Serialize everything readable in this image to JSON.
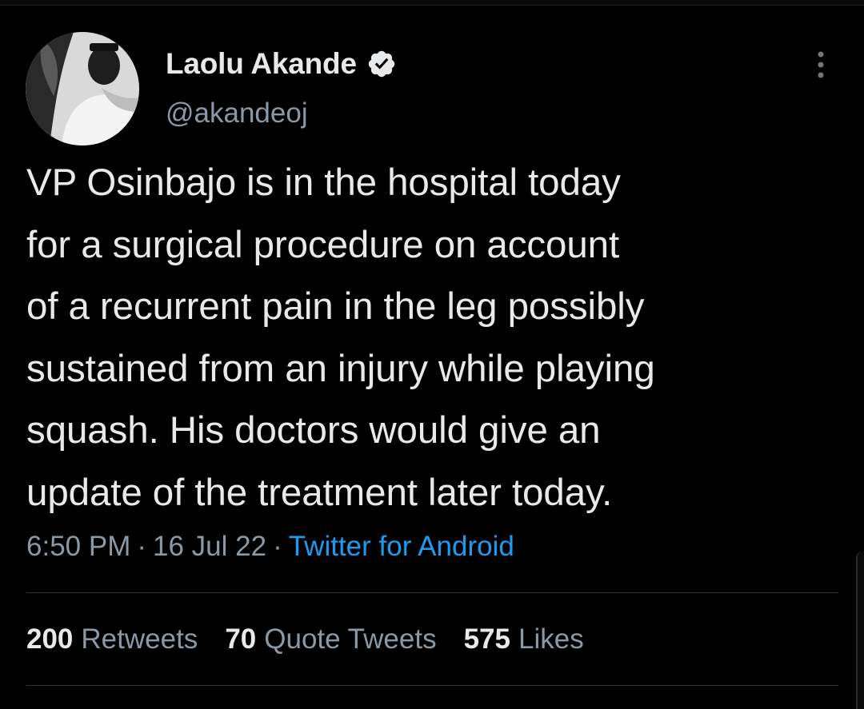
{
  "tweet": {
    "author": {
      "display_name": "Laolu Akande",
      "handle": "@akandeoj",
      "verified": true,
      "avatar_icon": "profile-photo"
    },
    "text": "VP Osinbajo is in the hospital today\nfor a surgical procedure on account\nof a recurrent pain in the leg possibly\nsustained from an injury while playing\nsquash. His doctors would give an\nupdate of the treatment later today.",
    "time": "6:50 PM",
    "date": "16 Jul 22",
    "separator": "·",
    "source": "Twitter for Android",
    "stats": [
      {
        "count": "200",
        "label": "Retweets"
      },
      {
        "count": "70",
        "label": "Quote Tweets"
      },
      {
        "count": "575",
        "label": "Likes"
      }
    ]
  },
  "colors": {
    "background": "#000000",
    "primary_text": "#e7e9ea",
    "secondary_text": "#8b98a5",
    "link": "#1d9bf0",
    "divider": "#2f3336"
  },
  "icons": {
    "verified": "verified-badge-icon",
    "more": "more-options-icon"
  }
}
